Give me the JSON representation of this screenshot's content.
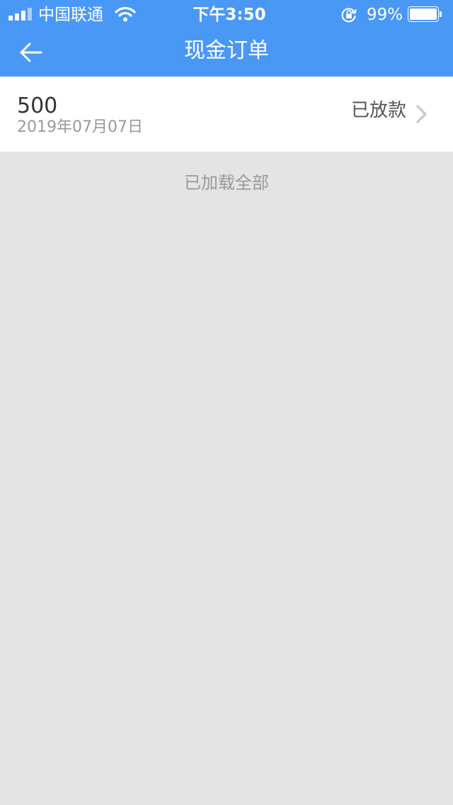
{
  "status_bar": {
    "carrier": "中国联通",
    "time": "下午3:50",
    "battery_percent": "99%",
    "battery_level": 0.99,
    "icons": [
      "signal-icon",
      "wifi-icon",
      "rotation-lock-icon",
      "battery-icon"
    ]
  },
  "nav": {
    "title": "现金订单",
    "back_icon": "arrow-left-icon"
  },
  "orders": [
    {
      "amount": "500",
      "date": "2019年07月07日",
      "status": "已放款",
      "icon": "chevron-right-icon"
    }
  ],
  "footer": {
    "load_all_text": "已加载全部"
  },
  "colors": {
    "header_bg": "#4a98f6",
    "page_bg": "#e4e4e4",
    "card_bg": "#ffffff",
    "primary_text": "#333333",
    "secondary_text": "#999999",
    "chevron": "#cccccc"
  }
}
